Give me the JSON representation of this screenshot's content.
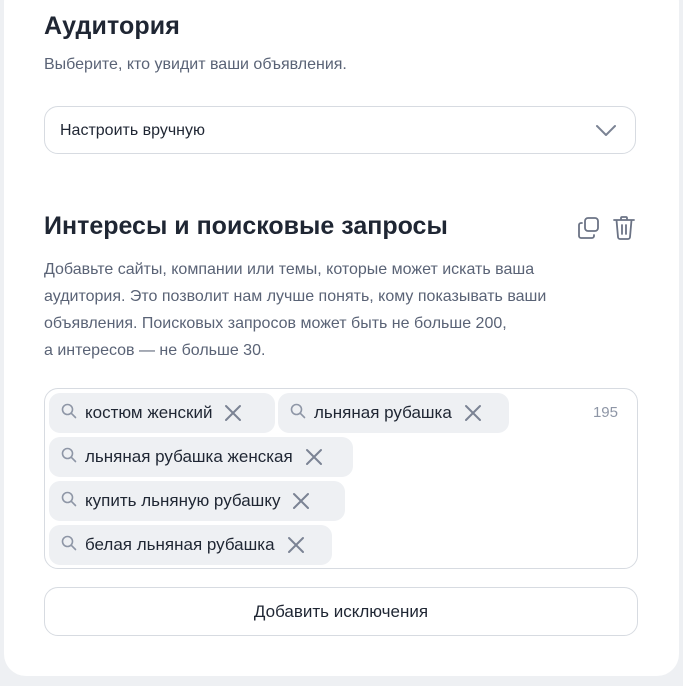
{
  "audience": {
    "title": "Аудитория",
    "subtitle": "Выберите, кто увидит ваши объявления.",
    "select_value": "Настроить вручную"
  },
  "interests": {
    "title": "Интересы и поисковые запросы",
    "description": [
      "Добавьте сайты, компании или темы, которые может искать ваша",
      "аудитория. Это позволит нам лучше понять, кому показывать ваши",
      "объявления. Поисковых запросов может быть не больше 200,",
      "а интересов — не больше 30."
    ],
    "counter": "195",
    "tags": [
      "костюм женский",
      "льняная рубашка",
      "льняная рубашка женская",
      "купить льняную рубашку",
      "белая льняная рубашка"
    ],
    "add_exclusions_label": "Добавить исключения"
  },
  "icons": {
    "copy": "copy-icon",
    "trash": "trash-icon",
    "search": "search-icon",
    "remove": "close-icon",
    "chevron": "chevron-down-icon"
  }
}
